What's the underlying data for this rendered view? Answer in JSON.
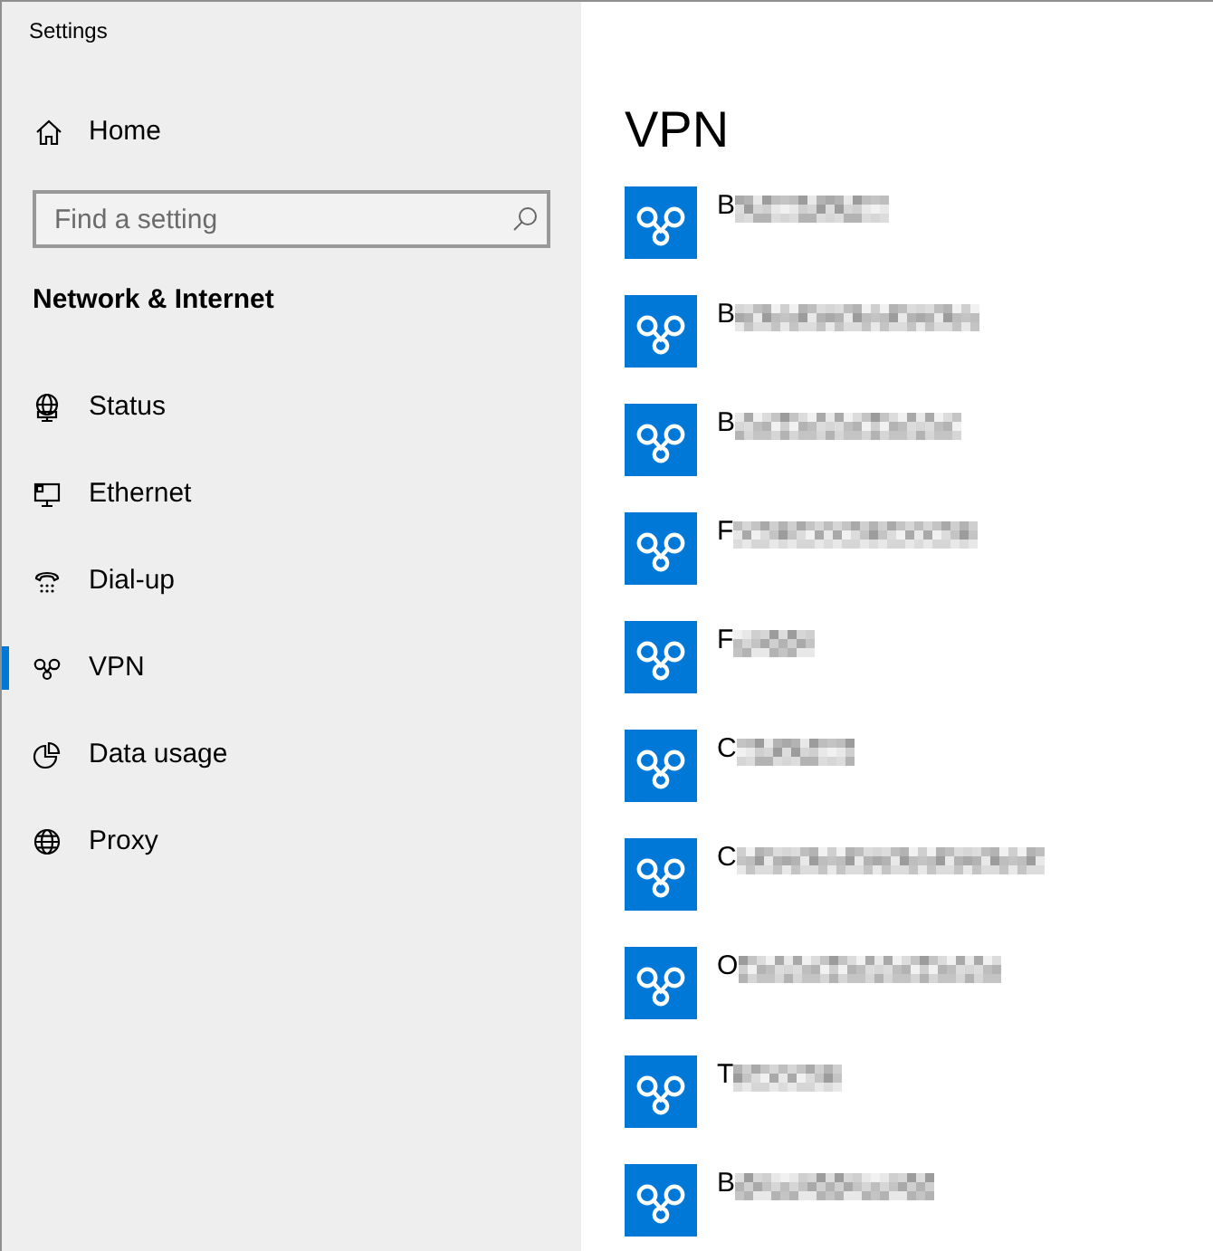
{
  "window": {
    "title": "Settings"
  },
  "sidebar": {
    "home": {
      "label": "Home"
    },
    "search": {
      "placeholder": "Find a setting"
    },
    "section_title": "Network & Internet",
    "items": [
      {
        "label": "Status",
        "selected": false
      },
      {
        "label": "Ethernet",
        "selected": false
      },
      {
        "label": "Dial-up",
        "selected": false
      },
      {
        "label": "VPN",
        "selected": true
      },
      {
        "label": "Data usage",
        "selected": false
      },
      {
        "label": "Proxy",
        "selected": false
      }
    ]
  },
  "main": {
    "title": "VPN",
    "connections": [
      {
        "name": "B",
        "blurred": true
      },
      {
        "name": "B",
        "blurred": true
      },
      {
        "name": "B",
        "blurred": true
      },
      {
        "name": "F",
        "blurred": true
      },
      {
        "name": "F",
        "blurred": true
      },
      {
        "name": "C",
        "blurred": true
      },
      {
        "name": "C",
        "blurred": true
      },
      {
        "name": "O",
        "blurred": true
      },
      {
        "name": "T",
        "blurred": true
      },
      {
        "name": "B",
        "blurred": true
      }
    ]
  }
}
